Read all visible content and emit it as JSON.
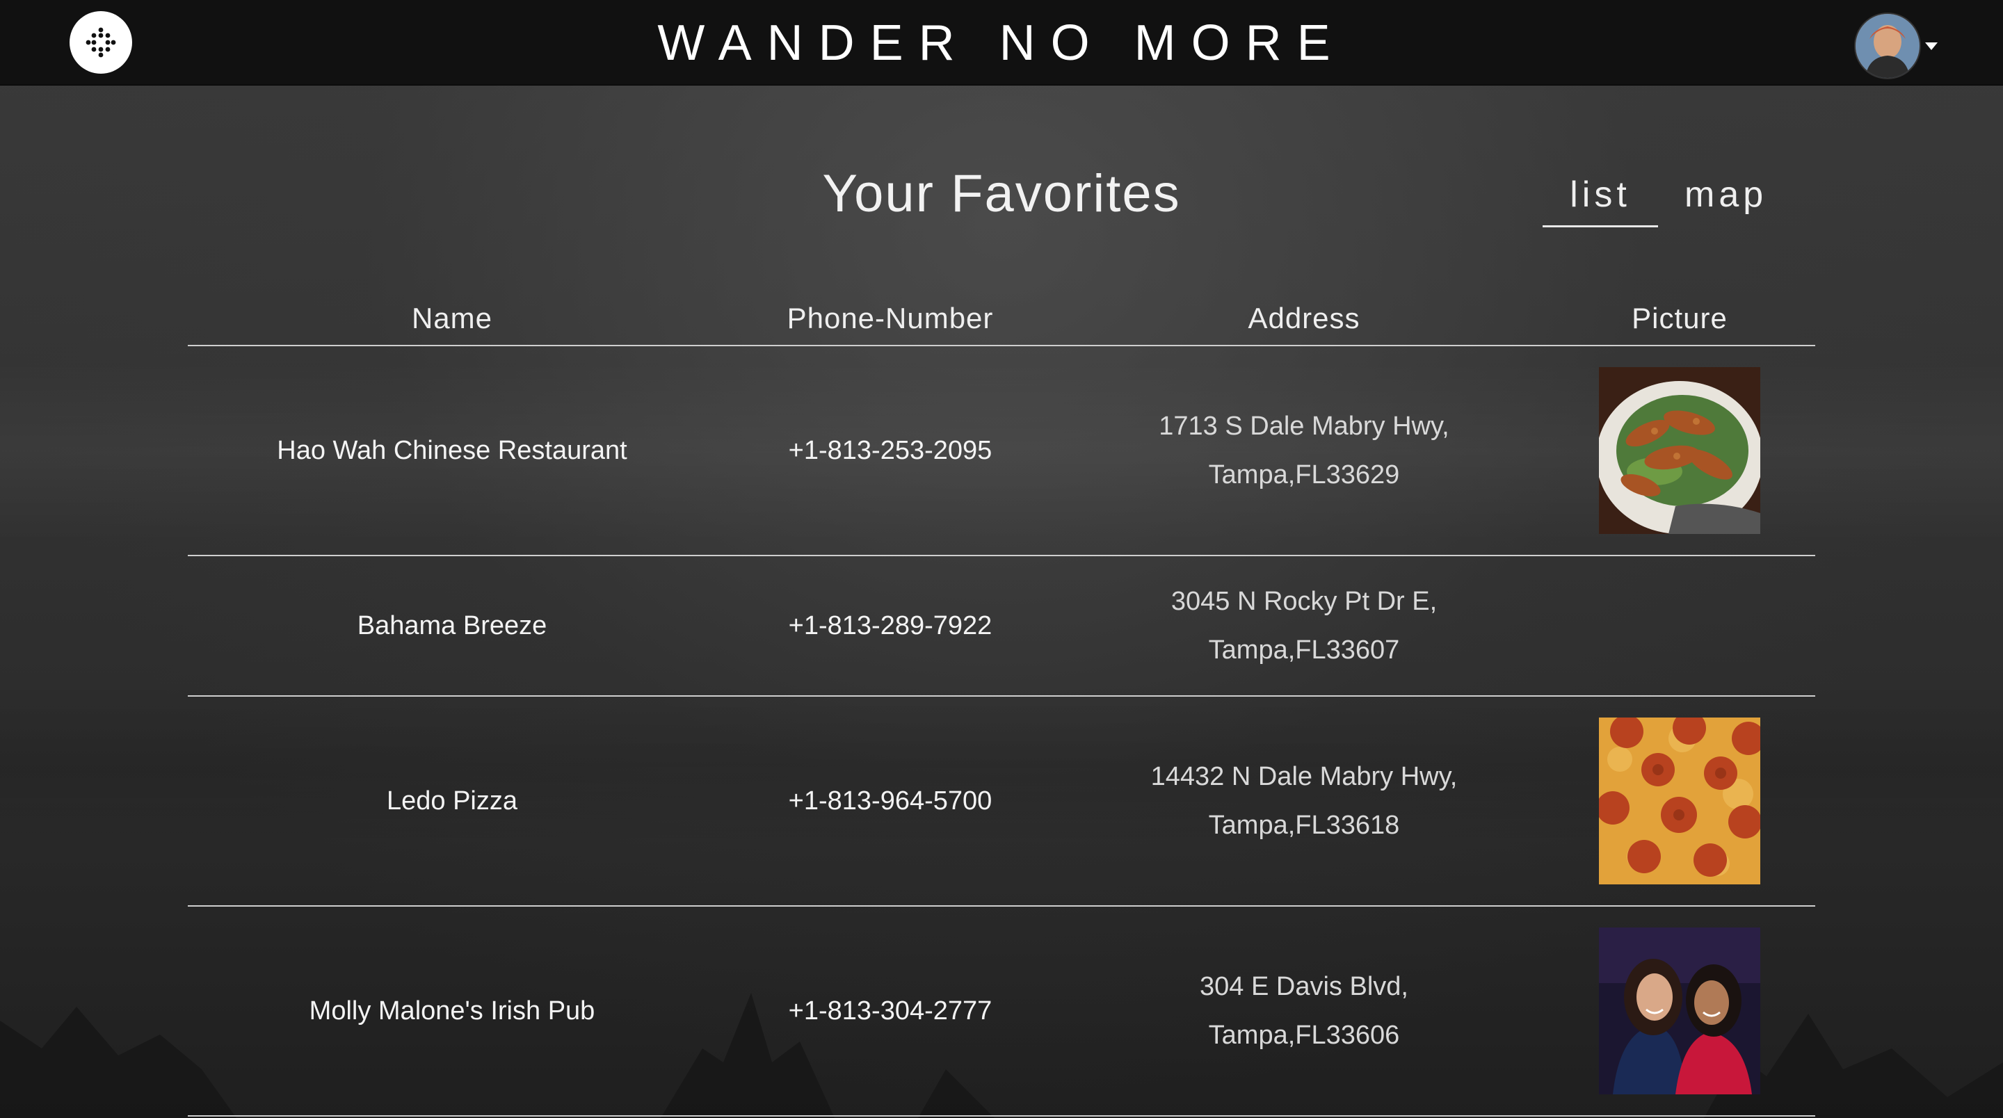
{
  "header": {
    "brand": "WANDER NO MORE",
    "logo_icon": "dots-logo-icon",
    "avatar_icon": "user-avatar",
    "menu_icon": "caret-down-icon"
  },
  "main": {
    "title": "Your Favorites",
    "view_tabs": [
      {
        "label": "list",
        "active": true
      },
      {
        "label": "map",
        "active": false
      }
    ]
  },
  "table": {
    "columns": [
      "Name",
      "Phone-Number",
      "Address",
      "Picture"
    ],
    "rows": [
      {
        "name": "Hao Wah Chinese Restaurant",
        "phone": "+1-813-253-2095",
        "address_line1": "1713 S Dale Mabry Hwy,",
        "address_line2": "Tampa,FL33629",
        "picture": "fried-food-photo"
      },
      {
        "name": "Bahama Breeze",
        "phone": "+1-813-289-7922",
        "address_line1": "3045 N Rocky Pt Dr E,",
        "address_line2": "Tampa,FL33607",
        "picture": ""
      },
      {
        "name": "Ledo Pizza",
        "phone": "+1-813-964-5700",
        "address_line1": "14432 N Dale Mabry Hwy,",
        "address_line2": "Tampa,FL33618",
        "picture": "pepperoni-pizza-photo"
      },
      {
        "name": "Molly Malone's Irish Pub",
        "phone": "+1-813-304-2777",
        "address_line1": "304 E Davis Blvd,",
        "address_line2": "Tampa,FL33606",
        "picture": "two-women-photo"
      }
    ]
  },
  "colors": {
    "topbar": "#111111",
    "background": "#2e2e2e",
    "text": "#efefef",
    "divider": "#cfcfcf"
  }
}
